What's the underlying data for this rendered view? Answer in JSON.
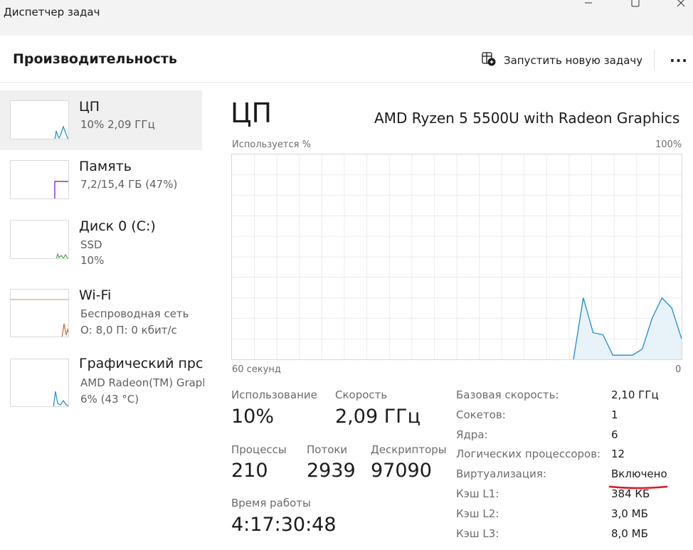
{
  "window": {
    "title": "Диспетчер задач"
  },
  "header": {
    "title": "Производительность",
    "run_task_label": "Запустить новую задачу",
    "more_label": "···"
  },
  "sidebar": {
    "items": [
      {
        "title": "ЦП",
        "sub1": "10%  2,09 ГГц",
        "sub2": "",
        "color": "#1f8dc6",
        "selected": true
      },
      {
        "title": "Память",
        "sub1": "7,2/15,4 ГБ (47%)",
        "sub2": "",
        "color": "#8b2fc9",
        "selected": false
      },
      {
        "title": "Диск 0 (C:)",
        "sub1": "SSD",
        "sub2": "10%",
        "color": "#4ca846",
        "selected": false
      },
      {
        "title": "Wi-Fi",
        "sub1": "Беспроводная сеть",
        "sub2": "О: 8,0  П: 0 кбит/с",
        "color": "#c26c35",
        "selected": false
      },
      {
        "title": "Графический прс",
        "sub1": "AMD Radeon(TM) Grapl",
        "sub2": "6%  (43 °C)",
        "color": "#1f8dc6",
        "selected": false
      }
    ]
  },
  "main": {
    "title": "ЦП",
    "model": "AMD Ryzen 5 5500U with Radeon Graphics",
    "graph": {
      "ylabel": "Используется %",
      "ymax_label": "100%",
      "xlabel": "60 секунд",
      "xmin_label": "0",
      "line_color": "#1f8dc6",
      "fill_color": "#e8f2f9",
      "grid_color": "#ececec",
      "values": [
        0,
        30,
        13,
        12,
        2,
        2,
        2,
        5,
        20,
        30,
        25,
        10
      ]
    },
    "stats": {
      "usage_label": "Использование",
      "usage_value": "10%",
      "speed_label": "Скорость",
      "speed_value": "2,09 ГГц",
      "processes_label": "Процессы",
      "processes_value": "210",
      "threads_label": "Потоки",
      "threads_value": "2939",
      "handles_label": "Дескрипторы",
      "handles_value": "97090",
      "uptime_label": "Время работы",
      "uptime_value": "4:17:30:48"
    },
    "specs": [
      {
        "label": "Базовая скорость:",
        "value": "2,10 ГГц"
      },
      {
        "label": "Сокетов:",
        "value": "1"
      },
      {
        "label": "Ядра:",
        "value": "6"
      },
      {
        "label": "Логических процессоров:",
        "value": "12"
      },
      {
        "label": "Виртуализация:",
        "value": "Включено"
      },
      {
        "label": "Кэш L1:",
        "value": "384 КБ"
      },
      {
        "label": "Кэш L2:",
        "value": "3,0 МБ"
      },
      {
        "label": "Кэш L3:",
        "value": "8,0 МБ"
      }
    ],
    "annotation_color": "#e0141e"
  }
}
